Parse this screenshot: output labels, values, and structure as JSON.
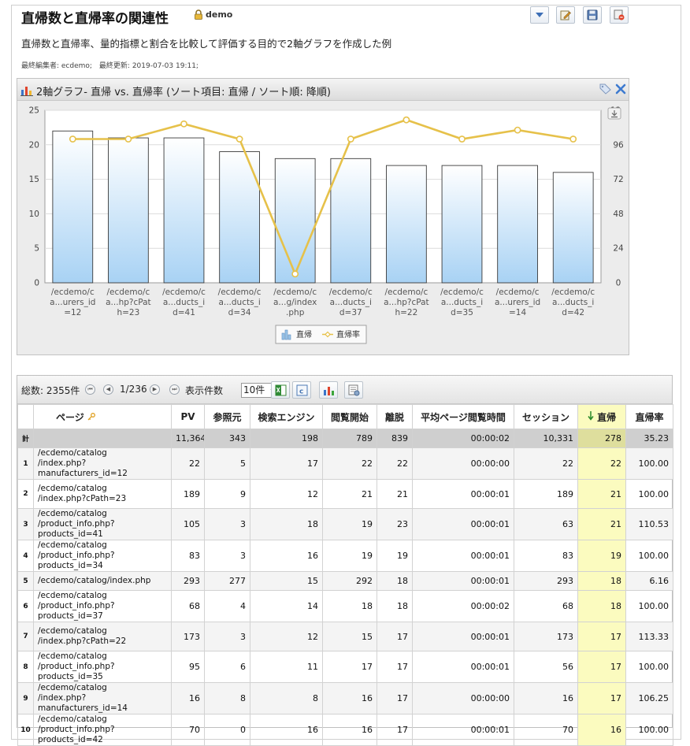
{
  "report": {
    "title": "直帰数と直帰率の関連性",
    "owner": "demo",
    "description": "直帰数と直帰率、量的指標と割合を比較して評価する目的で2軸グラフを作成した例",
    "meta": "最終編集者: ecdemo;　最終更新: 2019-07-03 19:11;"
  },
  "toolbar": {
    "icons": [
      "dropdown-icon",
      "edit-icon",
      "save-icon",
      "delete-icon"
    ]
  },
  "chart_panel": {
    "title": "2軸グラフ- 直帰 vs. 直帰率 (ソート項目: 直帰 / ソート順: 降順)",
    "icons": [
      "tag-icon",
      "close-icon",
      "download-icon"
    ]
  },
  "chart_data": {
    "type": "bar",
    "categories": [
      "/ecdemo/c a...urers_id =12",
      "/ecdemo/c a...hp?cPat h=23",
      "/ecdemo/c a...ducts_i d=41",
      "/ecdemo/c a...ducts_i d=34",
      "/ecdemo/c a...g/index .php",
      "/ecdemo/c a...ducts_i d=37",
      "/ecdemo/c a...hp?cPat h=22",
      "/ecdemo/c a...ducts_i d=35",
      "/ecdemo/c a...urers_id =14",
      "/ecdemo/c a...ducts_i d=42"
    ],
    "category_lines": [
      [
        "/ecdemo/c",
        "a...urers_id",
        "=12"
      ],
      [
        "/ecdemo/c",
        "a...hp?cPat",
        "h=23"
      ],
      [
        "/ecdemo/c",
        "a...ducts_i",
        "d=41"
      ],
      [
        "/ecdemo/c",
        "a...ducts_i",
        "d=34"
      ],
      [
        "/ecdemo/c",
        "a...g/index",
        ".php"
      ],
      [
        "/ecdemo/c",
        "a...ducts_i",
        "d=37"
      ],
      [
        "/ecdemo/c",
        "a...hp?cPat",
        "h=22"
      ],
      [
        "/ecdemo/c",
        "a...ducts_i",
        "d=35"
      ],
      [
        "/ecdemo/c",
        "a...urers_id",
        "=14"
      ],
      [
        "/ecdemo/c",
        "a...ducts_i",
        "d=42"
      ]
    ],
    "series": [
      {
        "name": "直帰",
        "type": "bar",
        "axis": "left",
        "values": [
          22,
          21,
          21,
          19,
          18,
          18,
          17,
          17,
          17,
          16
        ]
      },
      {
        "name": "直帰率",
        "type": "line",
        "axis": "right",
        "values": [
          100.0,
          100.0,
          110.53,
          100.0,
          6.16,
          100.0,
          113.33,
          100.0,
          106.25,
          100.0
        ]
      }
    ],
    "ylim": [
      0,
      25
    ],
    "yticks": [
      0,
      5,
      10,
      15,
      20,
      25
    ],
    "y2lim": [
      0,
      120
    ],
    "y2ticks": [
      0,
      24,
      48,
      72,
      96
    ],
    "y2_top_label": "12",
    "grid": true,
    "legend": "bottom-center",
    "colors": {
      "bar_top": "#ffffff",
      "bar_bottom": "#a8d2f4",
      "line": "#e6c14a"
    }
  },
  "table_toolbar": {
    "total": "総数: 2355件",
    "page": "1/236",
    "perpage_label": "表示件数",
    "perpage_value": "10件",
    "icons": [
      "first-page-icon",
      "prev-page-icon",
      "next-page-icon",
      "last-page-icon",
      "excel-icon",
      "csv-icon",
      "chart-icon",
      "settings-icon"
    ]
  },
  "table": {
    "columns": [
      "",
      "ページ",
      "PV",
      "参照元",
      "検索エンジン",
      "閲覧開始",
      "離脱",
      "平均ページ閲覧時間",
      "セッション",
      "直帰",
      "直帰率"
    ],
    "sort_column": "直帰",
    "total": [
      "計",
      "",
      "11,364",
      "343",
      "198",
      "789",
      "839",
      "00:00:02",
      "10,331",
      "278",
      "35.23"
    ],
    "rows": [
      [
        "1",
        "/ecdemo/catalog\n/index.php?manufacturers_id=12",
        "22",
        "5",
        "17",
        "22",
        "22",
        "00:00:00",
        "22",
        "22",
        "100.00"
      ],
      [
        "2",
        "/ecdemo/catalog\n/index.php?cPath=23",
        "189",
        "9",
        "12",
        "21",
        "21",
        "00:00:01",
        "189",
        "21",
        "100.00"
      ],
      [
        "3",
        "/ecdemo/catalog\n/product_info.php?products_id=41",
        "105",
        "3",
        "18",
        "19",
        "23",
        "00:00:01",
        "63",
        "21",
        "110.53"
      ],
      [
        "4",
        "/ecdemo/catalog\n/product_info.php?products_id=34",
        "83",
        "3",
        "16",
        "19",
        "19",
        "00:00:01",
        "83",
        "19",
        "100.00"
      ],
      [
        "5",
        "/ecdemo/catalog/index.php",
        "293",
        "277",
        "15",
        "292",
        "18",
        "00:00:01",
        "293",
        "18",
        "6.16"
      ],
      [
        "6",
        "/ecdemo/catalog\n/product_info.php?products_id=37",
        "68",
        "4",
        "14",
        "18",
        "18",
        "00:00:02",
        "68",
        "18",
        "100.00"
      ],
      [
        "7",
        "/ecdemo/catalog\n/index.php?cPath=22",
        "173",
        "3",
        "12",
        "15",
        "17",
        "00:00:01",
        "173",
        "17",
        "113.33"
      ],
      [
        "8",
        "/ecdemo/catalog\n/product_info.php?products_id=35",
        "95",
        "6",
        "11",
        "17",
        "17",
        "00:00:01",
        "56",
        "17",
        "100.00"
      ],
      [
        "9",
        "/ecdemo/catalog\n/index.php?manufacturers_id=14",
        "16",
        "8",
        "8",
        "16",
        "17",
        "00:00:00",
        "16",
        "17",
        "106.25"
      ],
      [
        "10",
        "/ecdemo/catalog\n/product_info.php?products_id=42",
        "70",
        "0",
        "16",
        "16",
        "17",
        "00:00:01",
        "70",
        "16",
        "100.00"
      ]
    ]
  }
}
